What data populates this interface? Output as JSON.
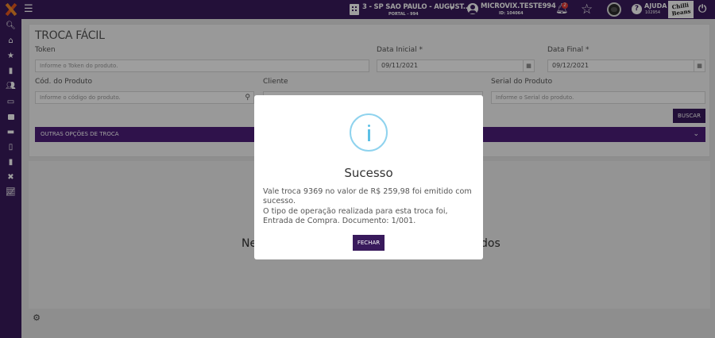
{
  "topbar": {
    "store_name": "3 - SP SAO PAULO - AUGUST...",
    "store_portal": "PORTAL - 994",
    "user_name": "MICROVIX.TESTE994",
    "user_id": "ID: 104064",
    "notifications_count": "2",
    "help_label": "AJUDA",
    "help_code": "102954",
    "brand_logo_text": "Chilli Beans"
  },
  "form": {
    "title": "TROCA FÁCIL",
    "token_label": "Token",
    "token_placeholder": "Informe o Token do produto.",
    "data_inicial_label": "Data Inicial *",
    "data_inicial_value": "09/11/2021",
    "data_final_label": "Data Final *",
    "data_final_value": "09/12/2021",
    "cod_produto_label": "Cód. do Produto",
    "cod_produto_placeholder": "Informe o código do produto.",
    "cliente_label": "Cliente",
    "serial_label": "Serial do Produto",
    "serial_placeholder": "Informe o Serial do produto.",
    "buscar_label": "BUSCAR",
    "outras_label": "OUTRAS OPÇÕES DE TROCA"
  },
  "results": {
    "empty_text_left": "Ne",
    "empty_text_right": "dos"
  },
  "modal": {
    "title": "Sucesso",
    "message_line1": "Vale troca 9369 no valor de R$ 259,98 foi emitido com sucesso.",
    "message_line2": "O tipo de operação realizada para esta troca foi, Entrada de Compra. Documento: 1/001.",
    "close_label": "FECHAR"
  }
}
